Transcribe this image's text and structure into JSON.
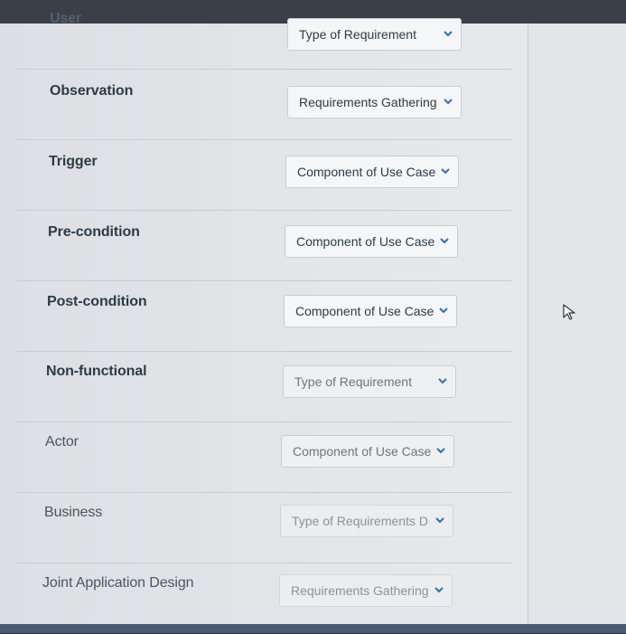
{
  "rows": [
    {
      "label": "User",
      "dropdown": "Type of Requirement"
    },
    {
      "label": "Observation",
      "dropdown": "Requirements Gathering"
    },
    {
      "label": "Trigger",
      "dropdown": "Component of Use Case"
    },
    {
      "label": "Pre-condition",
      "dropdown": "Component of Use Case"
    },
    {
      "label": "Post-condition",
      "dropdown": "Component of Use Case"
    },
    {
      "label": "Non-functional",
      "dropdown": "Type of Requirement"
    },
    {
      "label": "Actor",
      "dropdown": "Component of Use Case"
    },
    {
      "label": "Business",
      "dropdown": "Type of Requirements D"
    },
    {
      "label": "Joint Application Design",
      "dropdown": "Requirements Gathering"
    }
  ],
  "icons": {
    "dropdown": "chevron-down-icon",
    "pointer": "mouse-cursor-icon"
  },
  "colors": {
    "label_text": "#2d3b45",
    "select_bg": "#f5f6f7",
    "select_border": "#c7cdd1",
    "chevron": "#2d6ebf"
  }
}
